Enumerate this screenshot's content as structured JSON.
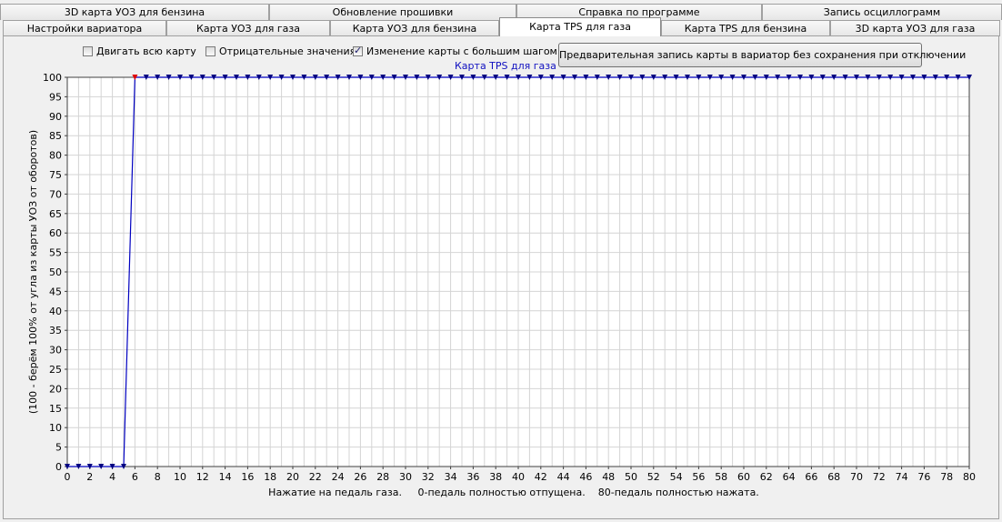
{
  "tabs_row1": [
    {
      "label": "3D карта УОЗ для бензина",
      "left": 0,
      "width": 296
    },
    {
      "label": "Обновление прошивки",
      "left": 296,
      "width": 272
    },
    {
      "label": "Справка по программе",
      "left": 568,
      "width": 270
    },
    {
      "label": "Запись осциллограмм",
      "left": 838,
      "width": 264
    }
  ],
  "tabs_row2": [
    {
      "label": "Настройки вариатора",
      "left": 3,
      "width": 180,
      "active": false
    },
    {
      "label": "Карта УОЗ для газа",
      "left": 183,
      "width": 180,
      "active": false
    },
    {
      "label": "Карта УОЗ для бензина",
      "left": 363,
      "width": 186,
      "active": false
    },
    {
      "label": "Карта TPS для газа",
      "left": 549,
      "width": 178,
      "active": true
    },
    {
      "label": "Карта TPS для бензина",
      "left": 727,
      "width": 186,
      "active": false
    },
    {
      "label": "3D карта УОЗ для газа",
      "left": 913,
      "width": 187,
      "active": false
    }
  ],
  "checkboxes": {
    "move_all": {
      "label": "Двигать всю карту",
      "checked": false
    },
    "negative": {
      "label": "Отрицательные значения",
      "checked": false
    },
    "big_step": {
      "label": "Изменение карты с большим шагом",
      "checked": true
    }
  },
  "preview_button": "Предварительная запись карты в вариатор без сохранения при отключении",
  "chart_data": {
    "type": "line",
    "title": "Карта TPS для газа",
    "xlabel": "Нажатие на педаль газа.     0-педаль полностью отпущена.    80-педаль полностью нажата.",
    "ylabel": "(100 - берём 100% от угла из карты УОЗ от оборотов)",
    "xlim": [
      0,
      80
    ],
    "ylim": [
      0,
      100
    ],
    "x_ticks": [
      0,
      2,
      4,
      6,
      8,
      10,
      12,
      14,
      16,
      18,
      20,
      22,
      24,
      26,
      28,
      30,
      32,
      34,
      36,
      38,
      40,
      42,
      44,
      46,
      48,
      50,
      52,
      54,
      56,
      58,
      60,
      62,
      64,
      66,
      68,
      70,
      72,
      74,
      76,
      78,
      80
    ],
    "y_ticks": [
      0,
      5,
      10,
      15,
      20,
      25,
      30,
      35,
      40,
      45,
      50,
      55,
      60,
      65,
      70,
      75,
      80,
      85,
      90,
      95,
      100
    ],
    "grid": true,
    "series": [
      {
        "color": "#0000c0",
        "marker_color": "#000080",
        "x": [
          0,
          1,
          2,
          3,
          4,
          5,
          6,
          7,
          8,
          9,
          10,
          11,
          12,
          13,
          14,
          15,
          16,
          17,
          18,
          19,
          20,
          21,
          22,
          23,
          24,
          25,
          26,
          27,
          28,
          29,
          30,
          31,
          32,
          33,
          34,
          35,
          36,
          37,
          38,
          39,
          40,
          41,
          42,
          43,
          44,
          45,
          46,
          47,
          48,
          49,
          50,
          51,
          52,
          53,
          54,
          55,
          56,
          57,
          58,
          59,
          60,
          61,
          62,
          63,
          64,
          65,
          66,
          67,
          68,
          69,
          70,
          71,
          72,
          73,
          74,
          75,
          76,
          77,
          78,
          79,
          80
        ],
        "y": [
          0,
          0,
          0,
          0,
          0,
          0,
          100,
          100,
          100,
          100,
          100,
          100,
          100,
          100,
          100,
          100,
          100,
          100,
          100,
          100,
          100,
          100,
          100,
          100,
          100,
          100,
          100,
          100,
          100,
          100,
          100,
          100,
          100,
          100,
          100,
          100,
          100,
          100,
          100,
          100,
          100,
          100,
          100,
          100,
          100,
          100,
          100,
          100,
          100,
          100,
          100,
          100,
          100,
          100,
          100,
          100,
          100,
          100,
          100,
          100,
          100,
          100,
          100,
          100,
          100,
          100,
          100,
          100,
          100,
          100,
          100,
          100,
          100,
          100,
          100,
          100,
          100,
          100,
          100,
          100,
          100
        ],
        "selected_index": 6,
        "selected_color": "#e00000"
      }
    ]
  }
}
